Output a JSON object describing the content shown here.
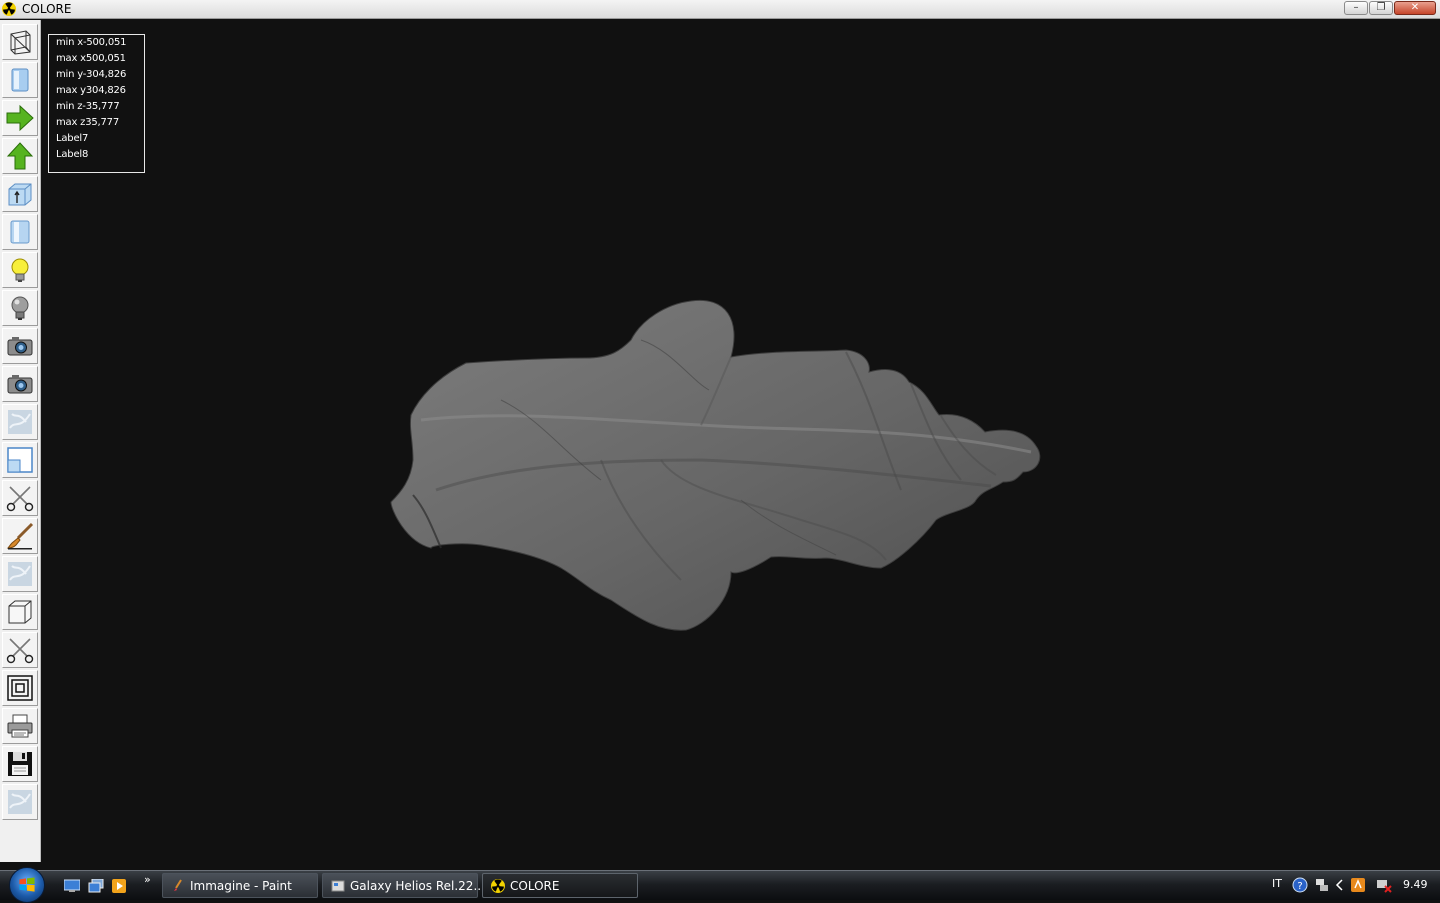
{
  "window": {
    "title": "COLORE",
    "minimize_glyph": "–",
    "maximize_glyph": "❐",
    "close_glyph": "✕"
  },
  "toolbar": {
    "tools": [
      {
        "name": "wireframe-box-tool",
        "icon": "wireframe-box-icon"
      },
      {
        "name": "solid-view-tool",
        "icon": "blue-panel-icon"
      },
      {
        "name": "arrow-right-tool",
        "icon": "green-arrow-right-icon"
      },
      {
        "name": "arrow-up-tool",
        "icon": "green-arrow-up-icon"
      },
      {
        "name": "height-box-tool",
        "icon": "height-box-icon"
      },
      {
        "name": "cylinder-tool",
        "icon": "blue-cylinder-icon"
      },
      {
        "name": "light-on-tool",
        "icon": "light-bulb-on-icon"
      },
      {
        "name": "light-off-tool",
        "icon": "light-bulb-off-icon"
      },
      {
        "name": "camera-tool-1",
        "icon": "camera-icon"
      },
      {
        "name": "camera-tool-2",
        "icon": "camera-icon"
      },
      {
        "name": "texture-tool-1",
        "icon": "marble-texture-icon"
      },
      {
        "name": "frame-tool",
        "icon": "frame-icon"
      },
      {
        "name": "cut-tool-1",
        "icon": "scissors-icon"
      },
      {
        "name": "paint-tool",
        "icon": "brush-icon"
      },
      {
        "name": "texture-tool-2",
        "icon": "marble-texture-icon"
      },
      {
        "name": "box-tool",
        "icon": "white-box-icon"
      },
      {
        "name": "cut-tool-2",
        "icon": "scissors-icon"
      },
      {
        "name": "contour-tool",
        "icon": "concentric-squares-icon"
      },
      {
        "name": "print-tool",
        "icon": "printer-icon"
      },
      {
        "name": "save-tool",
        "icon": "floppy-disk-icon"
      },
      {
        "name": "texture-tool-3",
        "icon": "marble-texture-icon"
      }
    ]
  },
  "info": {
    "lines": [
      "min x-500,051",
      "max x500,051",
      "min y-304,826",
      "max y304,826",
      "min z-35,777",
      "max z35,777",
      "Label7",
      "Label8"
    ]
  },
  "colors": {
    "viewport_bg": "#111111",
    "model_fill": "#6b6b6b",
    "model_shadow": "#454545",
    "model_highlight": "#8e8e8e"
  },
  "taskbar": {
    "quick_launch": [
      "desktop-icon",
      "window-switch-icon",
      "media-player-icon"
    ],
    "chevron": "»",
    "tasks": [
      {
        "label": "Immagine - Paint",
        "icon": "paint-icon",
        "active": false
      },
      {
        "label": "Galaxy Helios  Rel.22...",
        "icon": "galaxy-app-icon",
        "active": false
      },
      {
        "label": "COLORE",
        "icon": "radiation-icon",
        "active": true
      }
    ],
    "tray": {
      "language": "IT",
      "icons": [
        "help-icon",
        "network-icon",
        "arrow-left-icon",
        "app-tray-icon",
        "network-disconnected-icon"
      ],
      "clock": "9.49"
    }
  }
}
